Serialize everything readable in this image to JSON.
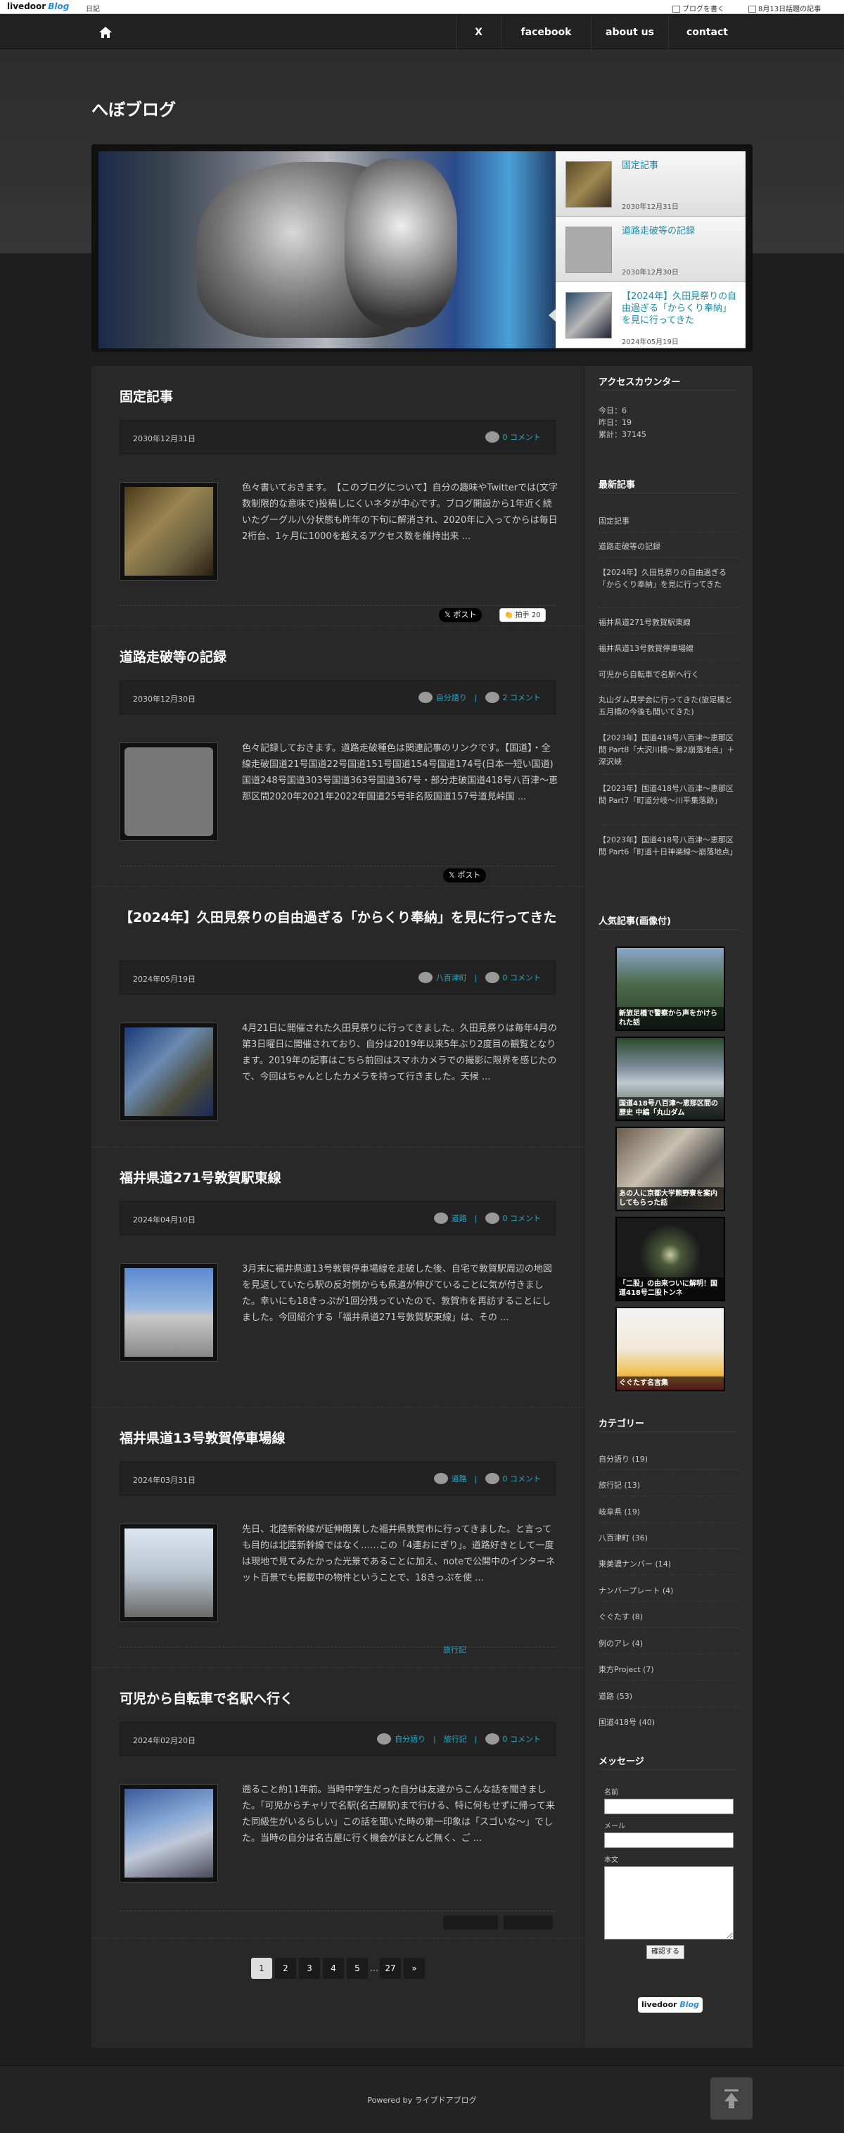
{
  "topbar": {
    "logo_main": "livedoor",
    "logo_sub": "Blog",
    "category": "日記",
    "write_link": "ブログを書く",
    "topic_link": "8月13日話題の記事"
  },
  "nav": {
    "items": [
      "X",
      "facebook",
      "about us",
      "contact"
    ]
  },
  "site": {
    "title": "へぼブログ"
  },
  "slider": {
    "items": [
      {
        "title": "固定記事",
        "date": "2030年12月31日"
      },
      {
        "title": "道路走破等の記録",
        "date": "2030年12月30日"
      },
      {
        "title": "【2024年】久田見祭りの自由過ぎる「からくり奉納」を見に行ってきた",
        "date": "2024年05月19日"
      }
    ]
  },
  "posts": [
    {
      "title": "固定記事",
      "date": "2030年12月31日",
      "tags": [],
      "comments": "0 コメント",
      "text": "色々書いておきます。　【このブログについて】自分の趣味やTwitterでは(文字数制限的な意味で)投稿しにくいネタが中心です。ブログ開設から1年近く続いたグーグル八分状態も昨年の下旬に解消され、2020年に入ってからは毎日2桁台、1ヶ月に1000を越えるアクセス数を維持出来 ...",
      "x_label": "ポスト",
      "clap_label": "拍手",
      "clap_count": "20"
    },
    {
      "title": "道路走破等の記録",
      "date": "2030年12月30日",
      "tags": [
        "自分語り"
      ],
      "comments": "2 コメント",
      "text": "色々記録しておきます。道路走破種色は関連記事のリンクです。【国道】・全線走破国道21号国道22号国道151号国道154号国道174号(日本一短い国道)国道248号国道303号国道363号国道367号・部分走破国道418号八百津〜恵那区間2020年2021年2022年国道25号非名阪国道157号道見峠国 ...",
      "x_label": "ポスト"
    },
    {
      "title": "【2024年】久田見祭りの自由過ぎる「からくり奉納」を見に行ってきた",
      "date": "2024年05月19日",
      "tags": [
        "八百津町"
      ],
      "comments": "0 コメント",
      "text": "4月21日に開催された久田見祭りに行ってきました。久田見祭りは毎年4月の第3日曜日に開催されており、自分は2019年以来5年ぶり2度目の観覧となります。2019年の記事はこちら前回はスマホカメラでの撮影に限界を感じたので、今回はちゃんとしたカメラを持って行きました。天候 ..."
    },
    {
      "title": "福井県道271号敦賀駅東線",
      "date": "2024年04月10日",
      "tags": [
        "道路"
      ],
      "comments": "0 コメント",
      "text": "3月末に福井県道13号敦賀停車場線を走破した後、自宅で敦賀駅周辺の地図を見返していたら駅の反対側からも県道が伸びていることに気が付きました。幸いにも18きっぷが1回分残っていたので、敦賀市を再訪することにしました。今回紹介する「福井県道271号敦賀駅東線」は、その ..."
    },
    {
      "title": "福井県道13号敦賀停車場線",
      "date": "2024年03月31日",
      "tags": [
        "道路"
      ],
      "comments": "0 コメント",
      "text": "先日、北陸新幹線が延伸開業した福井県敦賀市に行ってきました。と言っても目的は北陸新幹線ではなく……この「4連おにぎり」。道路好きとして一度は現地で見てみたかった光景であることに加え、noteで公開中のインターネット百景でも掲載中の物件ということで、18きっぷを使 ...",
      "footer_tag": "旅行記"
    },
    {
      "title": "可児から自転車で名駅へ行く",
      "date": "2024年02月20日",
      "tags": [
        "自分語り",
        "旅行記"
      ],
      "comments": "0 コメント",
      "text": "遡ること約11年前。当時中学生だった自分は友達からこんな話を聞きました。「可児からチャリで名駅(名古屋駅)まで行ける、特に何もせずに帰って来た同級生がいるらしい」この話を聞いた時の第一印象は「スゴいな〜」でした。当時の自分は名古屋に行く機会がほとんど無く、ご ..."
    }
  ],
  "pager": {
    "pages": [
      "1",
      "2",
      "3",
      "4",
      "5",
      "…",
      "27",
      "»"
    ]
  },
  "sidebar": {
    "counter_title": "アクセスカウンター",
    "counter_today": "今日：6",
    "counter_yesterday": "昨日：19",
    "counter_total": "累計：37145",
    "recent_title": "最新記事",
    "recent": [
      "固定記事",
      "道路走破等の記録",
      "【2024年】久田見祭りの自由過ぎる「からくり奉納」を見に行ってきた",
      "福井県道271号敦賀駅東線",
      "福井県道13号敦賀停車場線",
      "可児から自転車で名駅へ行く",
      "丸山ダム見学会に行ってきた(旅足橋と五月橋の今後も聞いてきた)",
      "【2023年】国道418号八百津〜恵那区間 Part8「大沢川橋〜第2崩落地点」＋深沢峡",
      "【2023年】国道418号八百津〜恵那区間 Part7「町道分岐〜川平集落跡」",
      "【2023年】国道418号八百津〜恵那区間 Part6「町道十日神楽線〜崩落地点」"
    ],
    "popular_title": "人気記事(画像付)",
    "popular": [
      "新旅足橋で警察から声をかけられた話",
      "国道418号八百津〜恵那区間の歴史 中編「丸山ダム",
      "あの人に京都大学熊野寮を案内してもらった話",
      "「二股」の由来ついに解明！国道418号二股トンネ",
      "ぐぐたす名言集"
    ],
    "category_title": "カテゴリー",
    "categories": [
      "自分語り (19)",
      "旅行記 (13)",
      "岐阜県 (19)",
      "八百津町 (36)",
      "東美濃ナンバー (14)",
      "ナンバープレート (4)",
      "ぐぐたす (8)",
      "例のアレ (4)",
      "東方Project (7)",
      "道路 (53)",
      "国道418号 (40)"
    ],
    "message_title": "メッセージ",
    "name_label": "名前",
    "mail_label": "メール",
    "body_label": "本文",
    "confirm_button": "確認する",
    "badge_main": "livedoor",
    "badge_sub": "Blog"
  },
  "footer": {
    "powered": "Powered by ライブドアブログ"
  },
  "colors": {
    "accent": "#2aa6c4",
    "background": "#1e1e1e",
    "panel": "#282828"
  }
}
